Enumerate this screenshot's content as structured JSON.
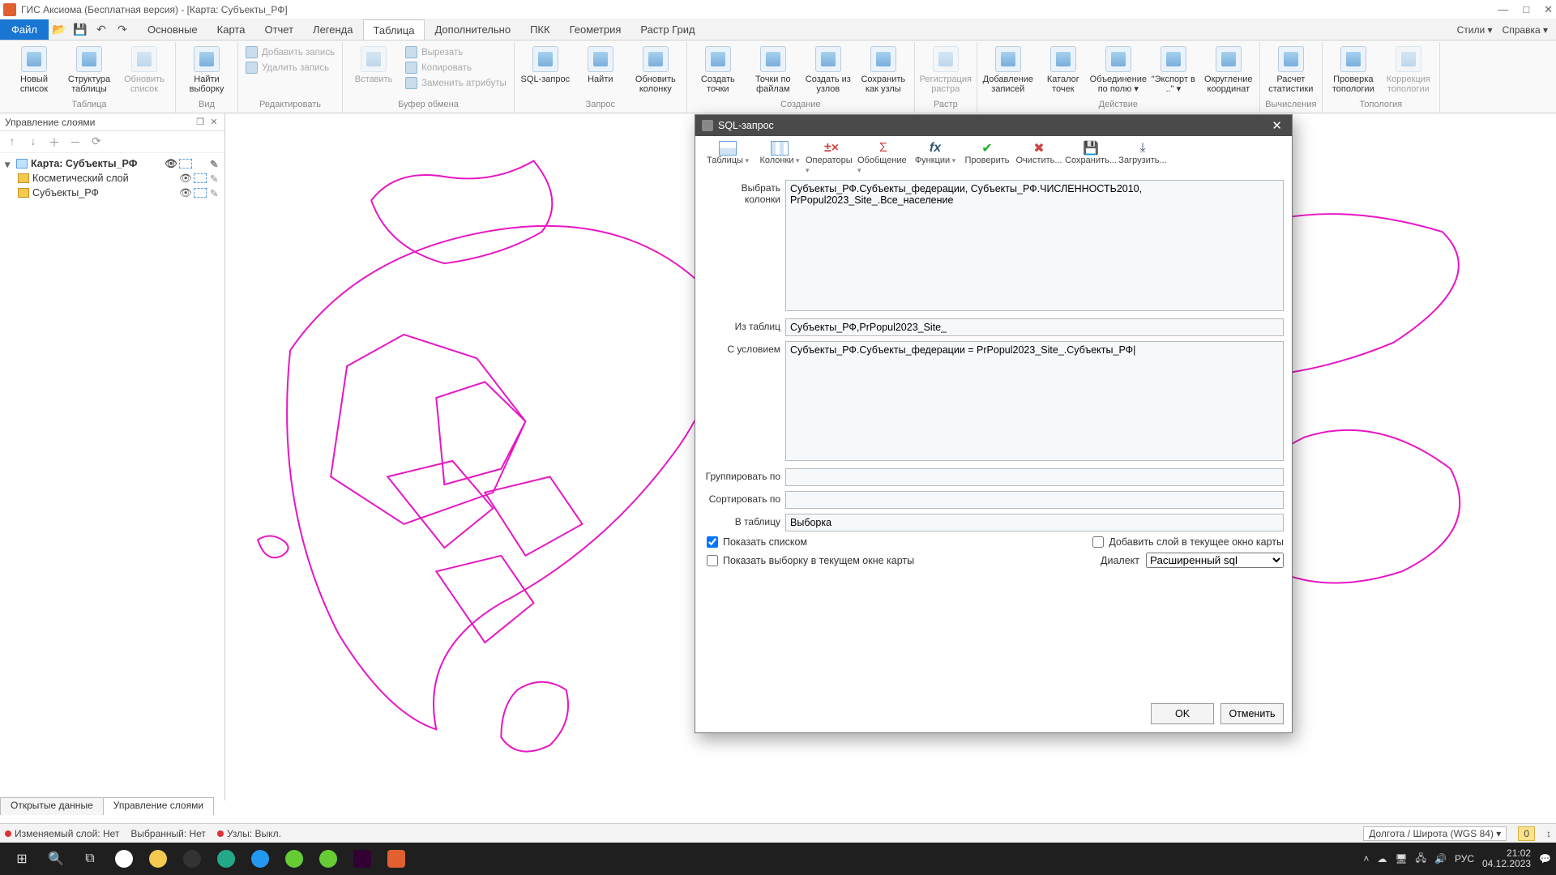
{
  "window": {
    "title": "ГИС Аксиома (Бесплатная версия) - [Карта: Субъекты_РФ]"
  },
  "menubar": {
    "file": "Файл",
    "tabs": [
      "Основные",
      "Карта",
      "Отчет",
      "Легенда",
      "Таблица",
      "Дополнительно",
      "ПКК",
      "Геометрия",
      "Растр Грид"
    ],
    "active_tab": "Таблица",
    "right": {
      "styles": "Стили ▾",
      "help": "Справка ▾"
    }
  },
  "ribbon": {
    "groups": {
      "table": {
        "label": "Таблица",
        "new_list": "Новый список",
        "structure": "Структура таблицы",
        "refresh": "Обновить список"
      },
      "view": {
        "label": "Вид",
        "find_selection": "Найти выборку"
      },
      "edit": {
        "label": "Редактировать",
        "add_row": "Добавить запись",
        "del_row": "Удалить запись",
        "cut": "Вырезать",
        "copy": "Копировать",
        "swap_attr": "Заменить атрибуты",
        "paste": "Вставить"
      },
      "clipboard": {
        "label": "Буфер обмена"
      },
      "query": {
        "label": "Запрос",
        "sql": "SQL-запрос",
        "find": "Найти",
        "update_col": "Обновить колонку"
      },
      "create": {
        "label": "Создание",
        "create_points": "Создать точки",
        "points_by_files": "Точки по файлам",
        "create_from_nodes": "Создать из узлов",
        "save_as_nodes": "Сохранить как узлы"
      },
      "raster": {
        "label": "Растр",
        "register": "Регистрация растра"
      },
      "action": {
        "label": "Действие",
        "add_rows": "Добавление записей",
        "point_catalog": "Каталог точек",
        "merge_by_field": "Объединение по полю ▾",
        "export_to": "\"Экспорт в ..\" ▾",
        "round_coords": "Округление координат"
      },
      "calc": {
        "label": "Вычисления",
        "stats": "Расчет статистики"
      },
      "topology": {
        "label": "Топология",
        "check": "Проверка топологии",
        "fix": "Коррекция топологии"
      }
    }
  },
  "layer_panel": {
    "title": "Управление слоями",
    "map_node": "Карта: Субъекты_РФ",
    "cosmetic": "Косметический слой",
    "layer": "Субъекты_РФ"
  },
  "bottom_tabs": {
    "open_data": "Открытые данные",
    "layers": "Управление слоями"
  },
  "statusbar": {
    "editable_layer": "Изменяемый слой: Нет",
    "selected": "Выбранный: Нет",
    "nodes": "Узлы: Выкл.",
    "projection": "Долгота / Широта (WGS 84) ▾",
    "warn": "0",
    "scroll": "↕"
  },
  "dialog": {
    "title": "SQL-запрос",
    "tools": {
      "tables": "Таблицы",
      "columns": "Колонки",
      "operators": "Операторы",
      "aggregation": "Обобщение",
      "functions": "Функции",
      "verify": "Проверить",
      "clear": "Очистить...",
      "save": "Сохранить...",
      "load": "Загрузить..."
    },
    "labels": {
      "select_cols": "Выбрать колонки",
      "from_tables": "Из таблиц",
      "where": "С условием",
      "group_by": "Группировать по",
      "order_by": "Сортировать по",
      "into_table": "В таблицу",
      "show_list": "Показать списком",
      "add_layer": "Добавить слой в текущее окно карты",
      "show_sel_in_map": "Показать выборку в текущем окне карты",
      "dialect": "Диалект"
    },
    "values": {
      "select_cols": "Субъекты_РФ.Субъекты_федерации, Субъекты_РФ.ЧИСЛЕННОСТЬ2010, PrPopul2023_Site_.Все_население",
      "from_tables": "Субъекты_РФ,PrPopul2023_Site_",
      "where": "Субъекты_РФ.Субъекты_федерации = PrPopul2023_Site_.Субъекты_РФ|",
      "group_by": "",
      "order_by": "",
      "into_table": "Выборка",
      "dialect": "Расширенный sql"
    },
    "buttons": {
      "ok": "OK",
      "cancel": "Отменить"
    }
  },
  "taskbar": {
    "time": "21:02",
    "date": "04.12.2023",
    "lang": "РУС"
  }
}
